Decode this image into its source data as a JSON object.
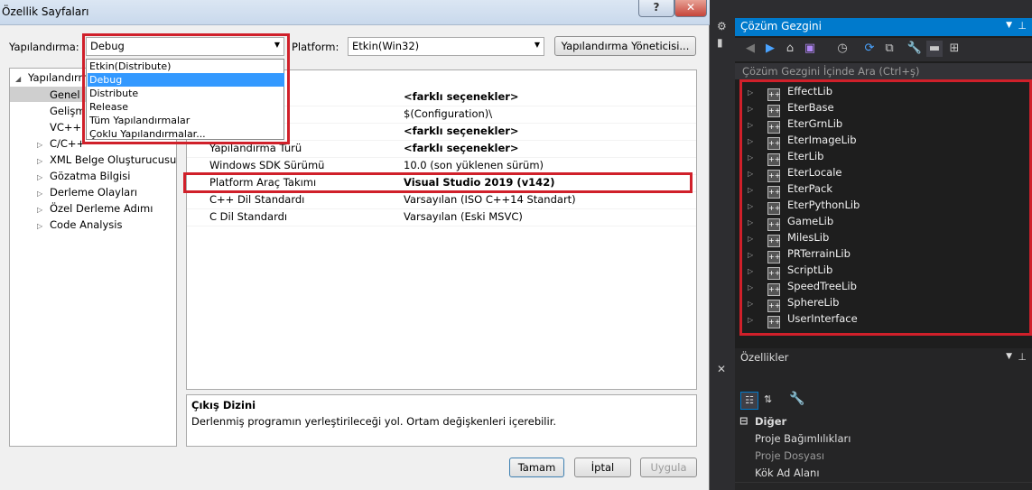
{
  "dialog": {
    "title": "Özellik Sayfaları",
    "help": "?",
    "close": "✕",
    "config_label": "Yapılandırma:",
    "config_value": "Debug",
    "platform_label": "Platform:",
    "platform_value": "Etkin(Win32)",
    "config_manager": "Yapılandırma Yöneticisi...",
    "dropdown_options": [
      "Etkin(Distribute)",
      "Debug",
      "Distribute",
      "Release",
      "Tüm Yapılandırmalar",
      "Çoklu Yapılandırmalar..."
    ],
    "tree": {
      "root": "Yapılandırm",
      "children": [
        "Genel",
        "Gelişm",
        "VC++ D",
        "C/C++",
        "XML Belge Oluşturucusu",
        "Gözatma Bilgisi",
        "Derleme Olayları",
        "Özel Derleme Adımı",
        "Code Analysis"
      ]
    },
    "grid_rows": [
      {
        "name": "",
        "value": "<farklı seçenekler>",
        "bold": true
      },
      {
        "name": "",
        "value": "$(Configuration)\\",
        "bold": false
      },
      {
        "name": "",
        "value": "<farklı seçenekler>",
        "bold": true
      },
      {
        "name": "Yapılandırma Türü",
        "value": "<farklı seçenekler>",
        "bold": true
      },
      {
        "name": "Windows SDK Sürümü",
        "value": "10.0 (son yüklenen sürüm)",
        "bold": false
      },
      {
        "name": "Platform Araç Takımı",
        "value": "Visual Studio 2019 (v142)",
        "bold": true
      },
      {
        "name": "C++ Dil Standardı",
        "value": "Varsayılan (ISO C++14 Standart)",
        "bold": false
      },
      {
        "name": "C Dil Standardı",
        "value": "Varsayılan (Eski MSVC)",
        "bold": false
      }
    ],
    "desc_title": "Çıkış Dizini",
    "desc_text": "Derlenmiş programın yerleştirileceği yol. Ortam değişkenleri içerebilir.",
    "ok": "Tamam",
    "cancel": "İptal",
    "apply": "Uygula"
  },
  "solution": {
    "title": "Çözüm Gezgini",
    "search_placeholder": "Çözüm Gezgini İçinde Ara (Ctrl+ş)",
    "projects": [
      "EffectLib",
      "EterBase",
      "EterGrnLib",
      "EterImageLib",
      "EterLib",
      "EterLocale",
      "EterPack",
      "EterPythonLib",
      "GameLib",
      "MilesLib",
      "PRTerrainLib",
      "ScriptLib",
      "SpeedTreeLib",
      "SphereLib",
      "UserInterface"
    ]
  },
  "properties": {
    "title": "Özellikler",
    "category": "Diğer",
    "rows": [
      "Proje Bağımlılıkları",
      "Proje Dosyası",
      "Kök Ad Alanı"
    ]
  },
  "colors": {
    "accent": "#007acc",
    "highlight": "#d0202a",
    "selection": "#3399ff"
  }
}
